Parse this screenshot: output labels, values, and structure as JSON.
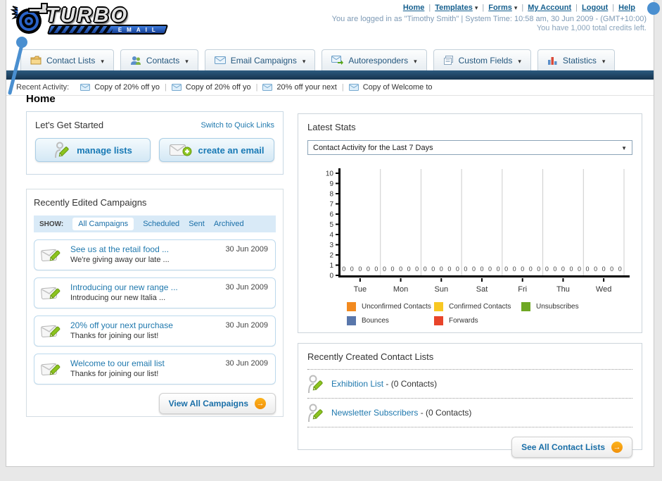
{
  "header": {
    "logo_title": "TURBO",
    "logo_subtitle": "EMAIL",
    "nav_links": [
      {
        "label": "Home"
      },
      {
        "label": "Templates"
      },
      {
        "label": "Forms"
      },
      {
        "label": "My Account"
      },
      {
        "label": "Logout"
      },
      {
        "label": "Help"
      }
    ],
    "status_line": "You are logged in as \"Timothy Smith\" | System Time: 10:58 am, 30 Jun 2009 - (GMT+10:00)",
    "credits_line": "You have 1,000 total credits left."
  },
  "nav_tabs": [
    {
      "label": "Contact Lists",
      "icon": "folder-icon"
    },
    {
      "label": "Contacts",
      "icon": "contacts-icon"
    },
    {
      "label": "Email Campaigns",
      "icon": "envelope-icon"
    },
    {
      "label": "Autoresponders",
      "icon": "autoresponder-icon"
    },
    {
      "label": "Custom Fields",
      "icon": "custom-fields-icon"
    },
    {
      "label": "Statistics",
      "icon": "statistics-icon"
    }
  ],
  "recent_activity": {
    "label": "Recent Activity:",
    "items": [
      {
        "text": "Copy of 20% off yo"
      },
      {
        "text": "Copy of 20% off yo"
      },
      {
        "text": "20% off your next"
      },
      {
        "text": "Copy of Welcome to"
      }
    ]
  },
  "page_title": "Home",
  "get_started": {
    "title": "Let's Get Started",
    "switch_link": "Switch to Quick Links",
    "manage_lists_label": "manage lists",
    "create_email_label": "create an email"
  },
  "campaigns": {
    "title": "Recently Edited Campaigns",
    "show_label": "SHOW:",
    "tabs": [
      {
        "label": "All Campaigns",
        "active": true
      },
      {
        "label": "Scheduled",
        "active": false
      },
      {
        "label": "Sent",
        "active": false
      },
      {
        "label": "Archived",
        "active": false
      }
    ],
    "items": [
      {
        "title": "See us at the retail food ...",
        "subtitle": "We're giving away our late ...",
        "date": "30 Jun 2009"
      },
      {
        "title": "Introducing our new range ...",
        "subtitle": "Introducing our new Italia ...",
        "date": "30 Jun 2009"
      },
      {
        "title": "20% off your next purchase",
        "subtitle": "Thanks for joining our list!",
        "date": "30 Jun 2009"
      },
      {
        "title": "Welcome to our email list",
        "subtitle": "Thanks for joining our list!",
        "date": "30 Jun 2009"
      }
    ],
    "view_all_label": "View All Campaigns"
  },
  "latest_stats": {
    "title": "Latest Stats",
    "selected_option": "Contact Activity for the Last 7 Days"
  },
  "chart_data": {
    "type": "bar",
    "title": "Contact Activity for the Last 7 Days",
    "categories": [
      "Tue",
      "Mon",
      "Sun",
      "Sat",
      "Fri",
      "Thu",
      "Wed"
    ],
    "series": [
      {
        "name": "Unconfirmed Contacts",
        "color": "#f28a1f",
        "values": [
          0,
          0,
          0,
          0,
          0,
          0,
          0
        ]
      },
      {
        "name": "Confirmed Contacts",
        "color": "#f8c822",
        "values": [
          0,
          0,
          0,
          0,
          0,
          0,
          0
        ]
      },
      {
        "name": "Unsubscribes",
        "color": "#6fa824",
        "values": [
          0,
          0,
          0,
          0,
          0,
          0,
          0
        ]
      },
      {
        "name": "Bounces",
        "color": "#5977ab",
        "values": [
          0,
          0,
          0,
          0,
          0,
          0,
          0
        ]
      },
      {
        "name": "Forwards",
        "color": "#e8442a",
        "values": [
          0,
          0,
          0,
          0,
          0,
          0,
          0
        ]
      }
    ],
    "ylim": [
      0,
      10
    ],
    "ytick_step": 1,
    "grid": true,
    "legend_position": "bottom",
    "value_labels_shown": true
  },
  "contact_lists": {
    "title": "Recently Created Contact Lists",
    "items": [
      {
        "name": "Exhibition List",
        "detail": "- (0 Contacts)"
      },
      {
        "name": "Newsletter Subscribers",
        "detail": "- (0 Contacts)"
      }
    ],
    "see_all_label": "See All Contact Lists"
  },
  "colors": {
    "dark_bar": "#1d3e5c",
    "link_blue": "#2079ae",
    "button_orange": "#f1900a",
    "panel_border": "#ccd6de",
    "show_bar_bg": "#d9eaf7"
  }
}
